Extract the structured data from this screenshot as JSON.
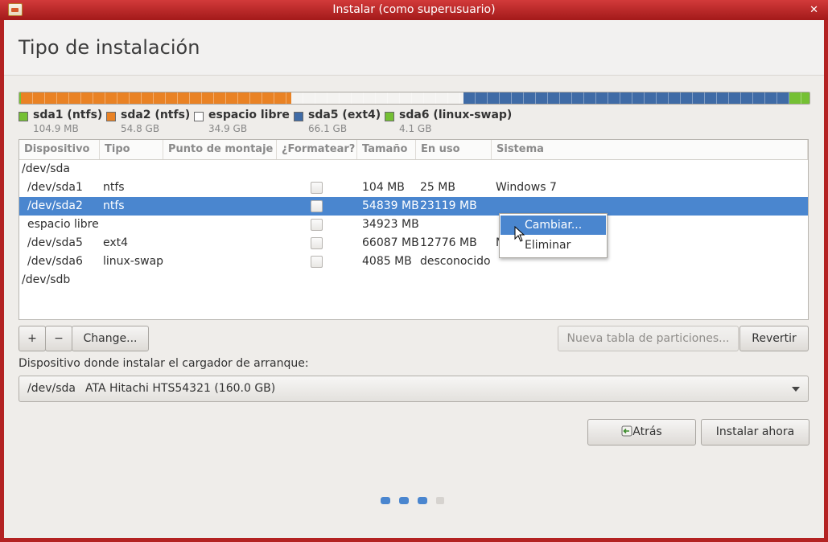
{
  "window": {
    "title": "Instalar (como superusuario)",
    "close_glyph": "✕"
  },
  "page": {
    "title": "Tipo de instalación"
  },
  "partition_bar": {
    "segments": [
      {
        "name": "sda1",
        "fraction": 0.002,
        "color": "#75c034"
      },
      {
        "name": "sda2",
        "fraction": 0.342,
        "color": "#e98224"
      },
      {
        "name": "espacio libre",
        "fraction": 0.218,
        "color": "#f4f3f1"
      },
      {
        "name": "sda5",
        "fraction": 0.413,
        "color": "#3f6ba6"
      },
      {
        "name": "sda6",
        "fraction": 0.025,
        "color": "#75c034"
      }
    ]
  },
  "legend": [
    {
      "label": "sda1 (ntfs)",
      "size": "104.9 MB",
      "color": "#75c034"
    },
    {
      "label": "sda2 (ntfs)",
      "size": "54.8 GB",
      "color": "#e98224"
    },
    {
      "label": "espacio libre",
      "size": "34.9 GB",
      "color": "#ffffff"
    },
    {
      "label": "sda5 (ext4)",
      "size": "66.1 GB",
      "color": "#3f6ba6"
    },
    {
      "label": "sda6 (linux-swap)",
      "size": "4.1 GB",
      "color": "#75c034"
    }
  ],
  "table": {
    "headers": [
      "Dispositivo",
      "Tipo",
      "Punto de montaje",
      "¿Formatear?",
      "Tamaño",
      "En uso",
      "Sistema"
    ],
    "rows": [
      {
        "device": "/dev/sda",
        "type": "",
        "mount": "",
        "format": null,
        "size": "",
        "used": "",
        "system": ""
      },
      {
        "device": "/dev/sda1",
        "type": "ntfs",
        "mount": "",
        "format": false,
        "size": "104 MB",
        "used": "25 MB",
        "system": "Windows 7"
      },
      {
        "device": "/dev/sda2",
        "type": "ntfs",
        "mount": "",
        "format": false,
        "size": "54839 MB",
        "used": "23119 MB",
        "system": ""
      },
      {
        "device": "espacio libre",
        "type": "",
        "mount": "",
        "format": false,
        "size": "34923 MB",
        "used": "",
        "system": ""
      },
      {
        "device": "/dev/sda5",
        "type": "ext4",
        "mount": "",
        "format": false,
        "size": "66087 MB",
        "used": "12776 MB",
        "system": "M"
      },
      {
        "device": "/dev/sda6",
        "type": "linux-swap",
        "mount": "",
        "format": false,
        "size": "4085 MB",
        "used": "desconocido",
        "system": ""
      },
      {
        "device": "/dev/sdb",
        "type": "",
        "mount": "",
        "format": null,
        "size": "",
        "used": "",
        "system": ""
      }
    ],
    "selected_row": 2
  },
  "context_menu": {
    "items": [
      "Cambiar...",
      "Eliminar"
    ],
    "active": 0
  },
  "toolbar": {
    "add": "+",
    "remove": "−",
    "change": "Change...",
    "new_table": "Nueva tabla de particiones...",
    "revert": "Revertir"
  },
  "bootloader": {
    "label": "Dispositivo donde instalar el cargador de arranque:",
    "device": "/dev/sda",
    "name": "ATA Hitachi HTS54321 (160.0 GB)"
  },
  "nav": {
    "back": "Atrás",
    "install": "Instalar ahora"
  },
  "progress": {
    "steps_total": 4,
    "steps_completed": 3,
    "active_color": "#4a86cf",
    "inactive_color": "#d6d3cf"
  }
}
